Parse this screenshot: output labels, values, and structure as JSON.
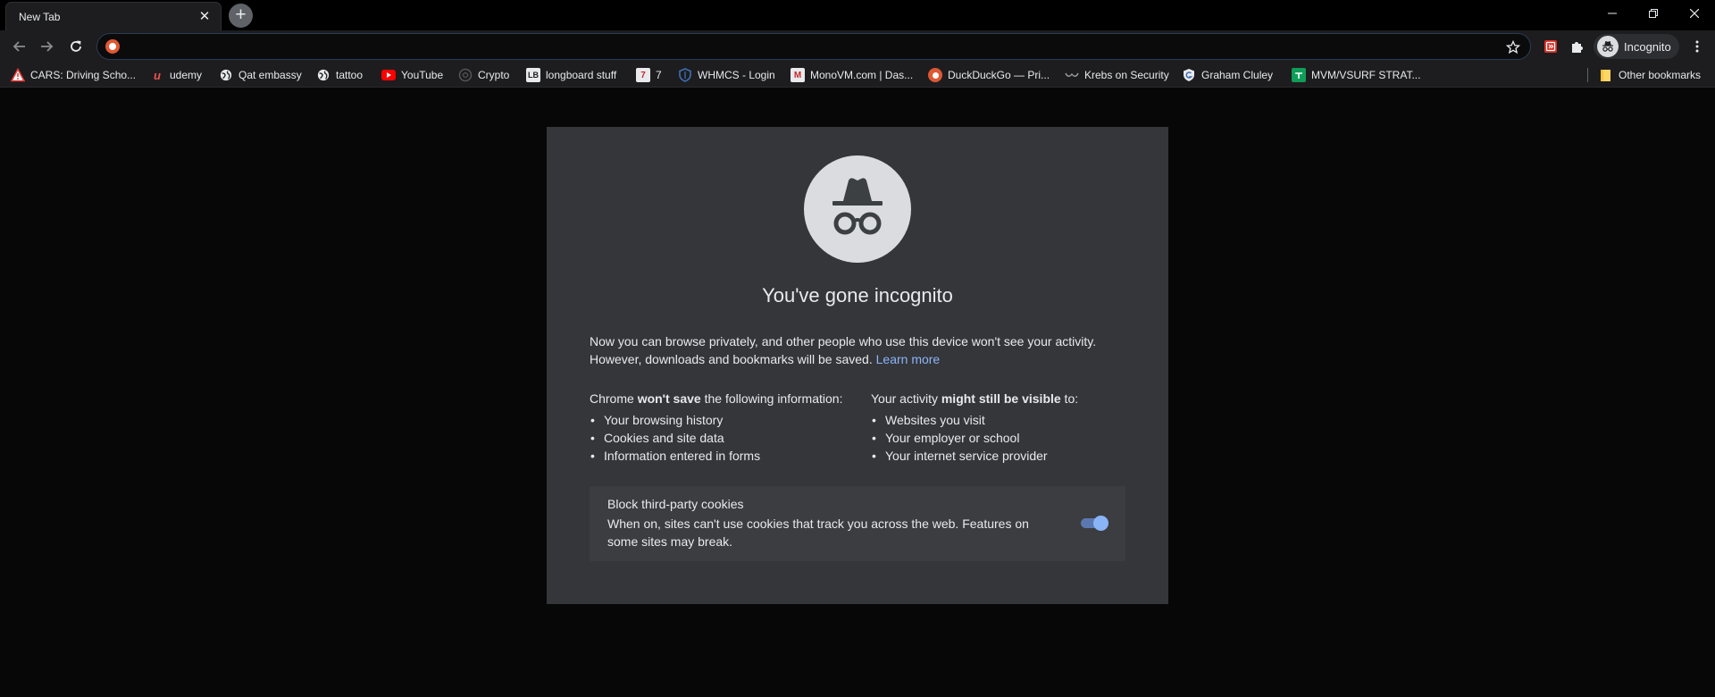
{
  "tab": {
    "title": "New Tab",
    "close": "✕"
  },
  "newtab": {
    "label": "+"
  },
  "toolbar": {
    "address_value": "",
    "incognito_label": "Incognito"
  },
  "bookmarks": [
    {
      "label": "CARS: Driving Scho...",
      "icon": "warning-triangle-icon",
      "color": "#e53935"
    },
    {
      "label": "udemy",
      "icon": "udemy-icon",
      "color": "#ec5252"
    },
    {
      "label": "Qat embassy",
      "icon": "globe-icon",
      "color": "#e8eaed"
    },
    {
      "label": "tattoo",
      "icon": "globe-icon",
      "color": "#e8eaed"
    },
    {
      "label": "YouTube",
      "icon": "youtube-icon",
      "color": "#ff0000"
    },
    {
      "label": "Crypto",
      "icon": "crypto-icon",
      "color": "#555"
    },
    {
      "label": "longboard stuff",
      "icon": "longboard-icon",
      "color": "#e8eaed"
    },
    {
      "label": "7",
      "icon": "seven-icon",
      "color": "#c62828"
    },
    {
      "label": "WHMCS - Login",
      "icon": "shield-icon",
      "color": "#3f6fb5"
    },
    {
      "label": "MonoVM.com | Das...",
      "icon": "monovm-icon",
      "color": "#c62828"
    },
    {
      "label": "DuckDuckGo — Pri...",
      "icon": "duckduckgo-icon",
      "color": "#de5833"
    },
    {
      "label": "Krebs on Security",
      "icon": "krebs-icon",
      "color": "#9aa0a6"
    },
    {
      "label": "Graham Cluley",
      "icon": "graham-cluley-icon",
      "color": "#8ab4f8"
    },
    {
      "label": "MVM/VSURF STRAT...",
      "icon": "sheets-icon",
      "color": "#0f9d58"
    }
  ],
  "other_bookmarks": "Other bookmarks",
  "page": {
    "title": "You've gone incognito",
    "intro_line1": "Now you can browse privately, and other people who use this device won't see your activity.",
    "intro_line2": "However, downloads and bookmarks will be saved.",
    "learn_more": "Learn more",
    "left_head_pre": "Chrome ",
    "left_head_bold": "won't save",
    "left_head_post": " the following information:",
    "left_items": [
      "Your browsing history",
      "Cookies and site data",
      "Information entered in forms"
    ],
    "right_head_pre": "Your activity ",
    "right_head_bold": "might still be visible",
    "right_head_post": " to:",
    "right_items": [
      "Websites you visit",
      "Your employer or school",
      "Your internet service provider"
    ],
    "cookies_title": "Block third-party cookies",
    "cookies_desc": "When on, sites can't use cookies that track you across the web. Features on some sites may break.",
    "cookies_enabled": true
  },
  "colors": {
    "accent": "#8ab4f8",
    "panel": "#35363a",
    "background": "#000000"
  }
}
